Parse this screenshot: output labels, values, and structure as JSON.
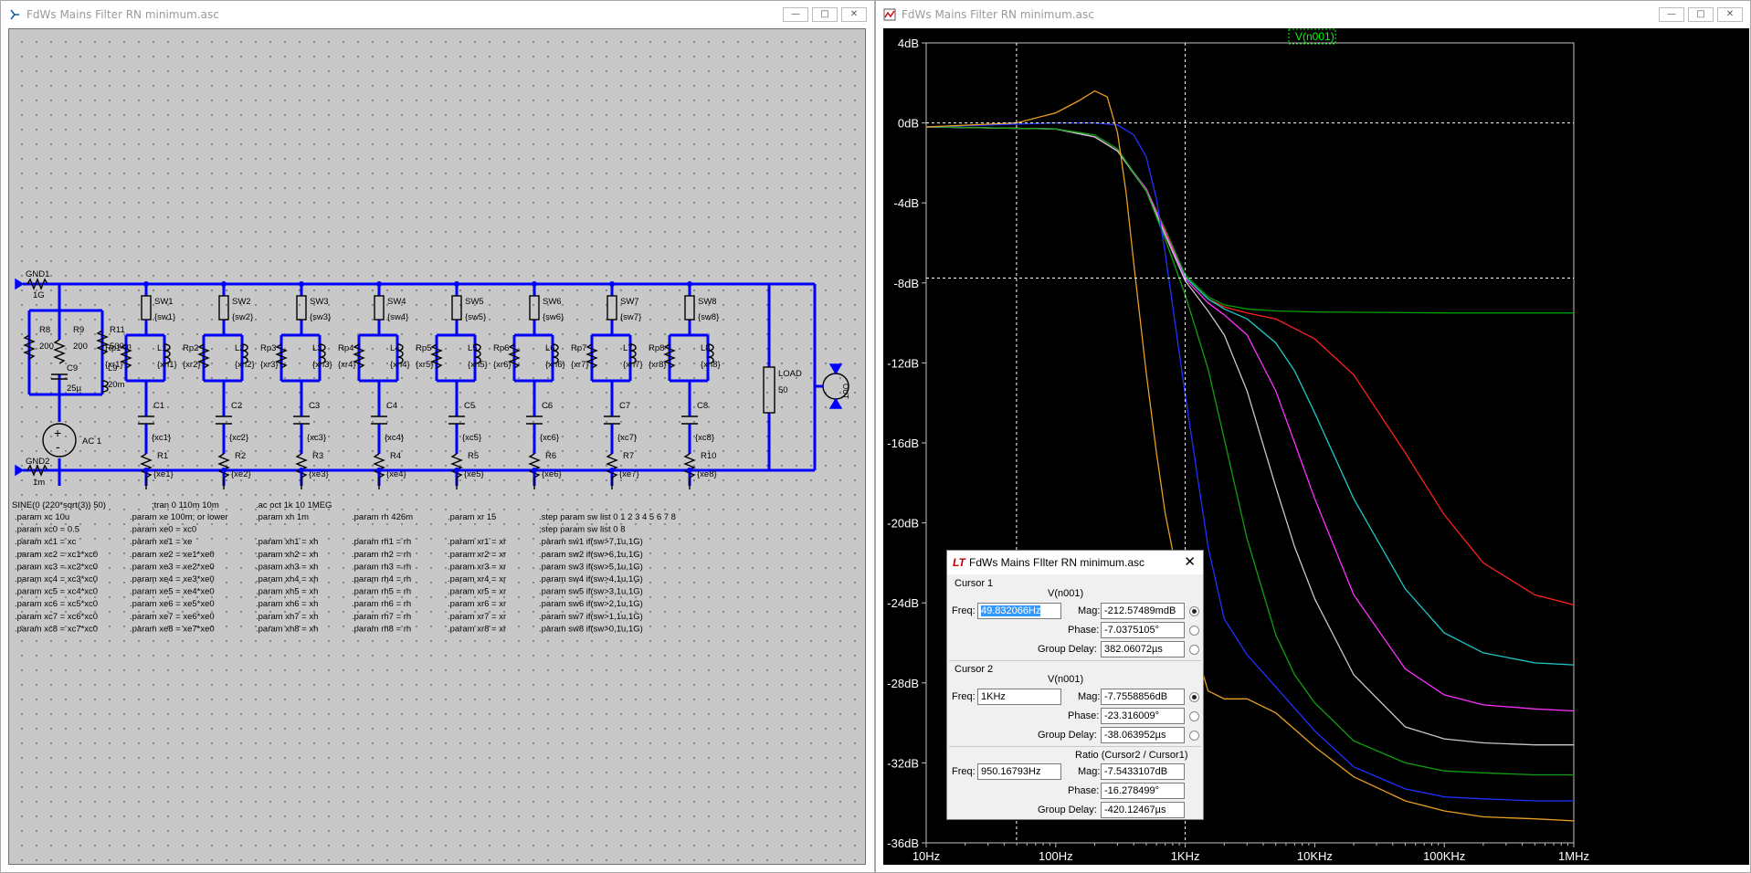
{
  "schematic_window": {
    "title": "FdWs Mains Filter RN minimum.asc",
    "buttons": {
      "minimize": "—",
      "maximize": "□",
      "close": "✕"
    }
  },
  "schematic": {
    "left_labels": {
      "gnd1": "GND1",
      "gnd1_val": "1G",
      "gnd2": "GND2",
      "gnd2_val": "1m",
      "r8": "R8",
      "r8_val": "200",
      "r9": "R9",
      "r9_val": "200",
      "c9": "C9",
      "c9_val": "25µ",
      "r11": "R11",
      "r11_val": "500m",
      "l9": "L9",
      "l9_val": "20m",
      "source": "AC 1"
    },
    "branches": [
      {
        "sw": "SW1",
        "sw_p": "{sw1}",
        "rp": "Rp1",
        "rp_p": "{xr1}",
        "l": "L1",
        "l_p": "{xh1}",
        "c": "C1",
        "c_p": "{xc1}",
        "r": "R1",
        "r_p": "{xe1}"
      },
      {
        "sw": "SW2",
        "sw_p": "{sw2}",
        "rp": "Rp2",
        "rp_p": "{xr2}",
        "l": "L2",
        "l_p": "{xh2}",
        "c": "C2",
        "c_p": "{xc2}",
        "r": "R2",
        "r_p": "{xe2}"
      },
      {
        "sw": "SW3",
        "sw_p": "{sw3}",
        "rp": "Rp3",
        "rp_p": "{xr3}",
        "l": "L3",
        "l_p": "{xh3}",
        "c": "C3",
        "c_p": "{xc3}",
        "r": "R3",
        "r_p": "{xe3}"
      },
      {
        "sw": "SW4",
        "sw_p": "{sw4}",
        "rp": "Rp4",
        "rp_p": "{xr4}",
        "l": "L4",
        "l_p": "{xh4}",
        "c": "C4",
        "c_p": "{xc4}",
        "r": "R4",
        "r_p": "{xe4}"
      },
      {
        "sw": "SW5",
        "sw_p": "{sw5}",
        "rp": "Rp5",
        "rp_p": "{xr5}",
        "l": "L5",
        "l_p": "{xh5}",
        "c": "C5",
        "c_p": "{xc5}",
        "r": "R5",
        "r_p": "{xe5}"
      },
      {
        "sw": "SW6",
        "sw_p": "{sw6}",
        "rp": "Rp6",
        "rp_p": "{xr6}",
        "l": "L6",
        "l_p": "{xh6}",
        "c": "C6",
        "c_p": "{xc6}",
        "r": "R6",
        "r_p": "{xe6}"
      },
      {
        "sw": "SW7",
        "sw_p": "{sw7}",
        "rp": "Rp7",
        "rp_p": "{xr7}",
        "l": "L7",
        "l_p": "{xh7}",
        "c": "C7",
        "c_p": "{xc7}",
        "r": "R7",
        "r_p": "{xe7}"
      },
      {
        "sw": "SW8",
        "sw_p": "{sw8}",
        "rp": "Rp8",
        "rp_p": "{xr8}",
        "l": "L8",
        "l_p": "{xh8}",
        "c": "C8",
        "c_p": "{xc8}",
        "r": "R10",
        "r_p": "{xe8}"
      }
    ],
    "load_label": "LOAD",
    "load_val": "50",
    "out_label": "OUT",
    "spice_lines": {
      "sine": "SINE(0 {220*sqrt(3)} 50)",
      "tran": ";tran 0 110m 10m",
      "ac": ".ac oct 1k 10 1MEG"
    },
    "param_columns": [
      [
        ".param xc 10u",
        ".param xc0 = 0.5",
        ".param xc1 = xc",
        ".param xc2 = xc1*xc0",
        ".param xc3 = xc2*xc0",
        ".param xc4 = xc3*xc0",
        ".param xc5 = xc4*xc0",
        ".param xc6 = xc5*xc0",
        ".param xc7 = xc6*xc0",
        ".param xc8 = xc7*xc0"
      ],
      [
        ".param xe 100m; or lower",
        ".param xe0 = xc0",
        ".param xe1 = xe",
        ".param xe2 = xe1*xe0",
        ".param xe3 = xe2*xe0",
        ".param xe4 = xe3*xe0",
        ".param xe5 = xe4*xe0",
        ".param xe6 = xe5*xe0",
        ".param xe7 = xe6*xe0",
        ".param xe8 = xe7*xe0"
      ],
      [
        ".param xh 1m",
        "",
        ".param xh1 = xh",
        ".param xh2 = xh",
        ".param xh3 = xh",
        ".param xh4 = xh",
        ".param xh5 = xh",
        ".param xh6 = xh",
        ".param xh7 = xh",
        ".param xh8 = xh"
      ],
      [
        ".param rh 426m",
        "",
        ".param rh1 = rh",
        ".param rh2 = rh",
        ".param rh3 = rh",
        ".param rh4 = rh",
        ".param rh5 = rh",
        ".param rh6 = rh",
        ".param rh7 = rh",
        ".param rh8 = rh"
      ],
      [
        ".param xr 15",
        "",
        ".param xr1 = xr",
        ".param xr2 = xr",
        ".param xr3 = xr",
        ".param xr4 = xr",
        ".param xr5 = xr",
        ".param xr6 = xr",
        ".param xr7 = xr",
        ".param xr8 = xr"
      ],
      [
        ".step param sw list 0 1 2 3 4 5 6 7 8",
        ";step param sw list 0 8",
        ".param sw1 if(sw>7,1u,1G)",
        ".param sw2 if(sw>6,1u,1G)",
        ".param sw3 if(sw>5,1u,1G)",
        ".param sw4 if(sw>4,1u,1G)",
        ".param sw5 if(sw>3,1u,1G)",
        ".param sw6 if(sw>2,1u,1G)",
        ".param sw7 if(sw>1,1u,1G)",
        ".param sw8 if(sw>0,1u,1G)"
      ]
    ]
  },
  "plot_window": {
    "title": "FdWs Mains Filter RN minimum.asc",
    "buttons": {
      "minimize": "—",
      "maximize": "□",
      "close": "✕"
    },
    "trace_label": "V(n001)"
  },
  "chart_data": {
    "type": "line",
    "xscale": "log",
    "xlim": [
      10,
      1000000
    ],
    "ylim": [
      -36,
      4
    ],
    "x_ticks": [
      10,
      100,
      1000,
      10000,
      100000,
      1000000
    ],
    "x_tick_labels": [
      "10Hz",
      "100Hz",
      "1KHz",
      "10KHz",
      "100KHz",
      "1MHz"
    ],
    "y_ticks": [
      4,
      0,
      -4,
      -8,
      -12,
      -16,
      -20,
      -24,
      -28,
      -32,
      -36
    ],
    "y_tick_labels": [
      "4dB",
      "0dB",
      "-4dB",
      "-8dB",
      "-12dB",
      "-16dB",
      "-20dB",
      "-24dB",
      "-28dB",
      "-32dB",
      "-36dB"
    ],
    "cursors": {
      "x1": 49.83,
      "x2": 1000,
      "y1": 0,
      "y2": -7.76
    },
    "series": [
      {
        "color": "#00a000",
        "x": [
          10,
          100,
          200,
          300,
          500,
          700,
          1000,
          1500,
          2000,
          3000,
          5000,
          10000,
          100000,
          1000000
        ],
        "y": [
          -0.2,
          -0.3,
          -0.7,
          -1.4,
          -3.3,
          -5.3,
          -7.6,
          -8.7,
          -9.1,
          -9.3,
          -9.4,
          -9.45,
          -9.5,
          -9.5
        ]
      },
      {
        "color": "#ff2020",
        "x": [
          10,
          100,
          200,
          300,
          500,
          700,
          1000,
          1500,
          2000,
          3000,
          5000,
          10000,
          20000,
          50000,
          100000,
          200000,
          500000,
          1000000
        ],
        "y": [
          -0.2,
          -0.3,
          -0.7,
          -1.4,
          -3.3,
          -5.4,
          -7.7,
          -8.8,
          -9.2,
          -9.5,
          -9.8,
          -10.8,
          -12.6,
          -16.5,
          -19.6,
          -22.0,
          -23.6,
          -24.1
        ]
      },
      {
        "color": "#1fc8c8",
        "x": [
          10,
          100,
          200,
          300,
          500,
          700,
          1000,
          1500,
          2000,
          3000,
          5000,
          7000,
          10000,
          20000,
          50000,
          100000,
          200000,
          500000,
          1000000
        ],
        "y": [
          -0.2,
          -0.3,
          -0.7,
          -1.4,
          -3.3,
          -5.5,
          -7.7,
          -8.8,
          -9.3,
          -9.8,
          -11.0,
          -12.4,
          -14.5,
          -18.8,
          -23.3,
          -25.5,
          -26.5,
          -27.0,
          -27.1
        ]
      },
      {
        "color": "#ff30ff",
        "x": [
          10,
          100,
          200,
          300,
          500,
          700,
          1000,
          1500,
          2000,
          3000,
          5000,
          7000,
          10000,
          20000,
          50000,
          100000,
          200000,
          500000,
          1000000
        ],
        "y": [
          -0.2,
          -0.3,
          -0.7,
          -1.4,
          -3.3,
          -5.5,
          -7.8,
          -9.0,
          -9.6,
          -10.6,
          -13.4,
          -16.0,
          -18.8,
          -23.6,
          -27.3,
          -28.6,
          -29.1,
          -29.3,
          -29.4
        ]
      },
      {
        "color": "#c8c8c8",
        "x": [
          10,
          100,
          200,
          300,
          500,
          700,
          1000,
          1500,
          2000,
          3000,
          5000,
          7000,
          10000,
          20000,
          50000,
          100000,
          200000,
          500000,
          1000000
        ],
        "y": [
          -0.2,
          -0.3,
          -0.7,
          -1.4,
          -3.4,
          -5.6,
          -7.9,
          -9.4,
          -10.6,
          -13.4,
          -18.2,
          -21.2,
          -23.8,
          -27.6,
          -30.2,
          -30.8,
          -31.0,
          -31.1,
          -31.1
        ]
      },
      {
        "color": "#10a010",
        "x": [
          10,
          100,
          200,
          300,
          500,
          700,
          1000,
          1500,
          2000,
          3000,
          5000,
          7000,
          10000,
          20000,
          50000,
          100000,
          200000,
          500000,
          1000000
        ],
        "y": [
          -0.2,
          -0.3,
          -0.6,
          -1.3,
          -3.4,
          -5.8,
          -8.6,
          -12.3,
          -15.8,
          -20.8,
          -25.6,
          -27.6,
          -29.0,
          -30.9,
          -32.0,
          -32.4,
          -32.5,
          -32.6,
          -32.6
        ]
      },
      {
        "color": "#2030ff",
        "x": [
          10,
          100,
          200,
          300,
          400,
          500,
          600,
          700,
          1000,
          1500,
          2000,
          3000,
          5000,
          10000,
          20000,
          50000,
          100000,
          200000,
          500000,
          1000000
        ],
        "y": [
          -0.2,
          0.0,
          0.0,
          -0.1,
          -0.6,
          -1.7,
          -3.8,
          -6.5,
          -13.6,
          -21.2,
          -24.8,
          -26.6,
          -28.2,
          -30.4,
          -32.2,
          -33.3,
          -33.7,
          -33.8,
          -33.9,
          -33.9
        ]
      },
      {
        "color": "#e8a020",
        "x": [
          10,
          50,
          100,
          150,
          200,
          250,
          300,
          350,
          400,
          500,
          600,
          700,
          1000,
          1500,
          2000,
          3000,
          5000,
          10000,
          20000,
          50000,
          100000,
          200000,
          500000,
          1000000
        ],
        "y": [
          -0.2,
          0.0,
          0.5,
          1.1,
          1.6,
          1.3,
          -0.5,
          -3.5,
          -7.0,
          -12.5,
          -16.5,
          -19.5,
          -24.6,
          -28.4,
          -28.8,
          -28.8,
          -29.5,
          -31.2,
          -32.7,
          -33.9,
          -34.4,
          -34.7,
          -34.8,
          -34.9
        ]
      }
    ]
  },
  "cursor_dialog": {
    "title": "FdWs Mains FIlter RN minimum.asc",
    "cursor1": {
      "heading": "Cursor 1",
      "trace": "V(n001)",
      "freq_label": "Freq:",
      "freq": "49.832066Hz",
      "mag_label": "Mag:",
      "mag": "-212.57489mdB",
      "phase_label": "Phase:",
      "phase": "-7.0375105°",
      "gd_label": "Group Delay:",
      "gd": "382.06072µs"
    },
    "cursor2": {
      "heading": "Cursor 2",
      "trace": "V(n001)",
      "freq_label": "Freq:",
      "freq": "1KHz",
      "mag_label": "Mag:",
      "mag": "-7.7558856dB",
      "phase_label": "Phase:",
      "phase": "-23.316009°",
      "gd_label": "Group Delay:",
      "gd": "-38.063952µs"
    },
    "ratio": {
      "heading": "Ratio (Cursor2 / Cursor1)",
      "freq_label": "Freq:",
      "freq": "950.16793Hz",
      "mag_label": "Mag:",
      "mag": "-7.5433107dB",
      "phase_label": "Phase:",
      "phase": "-16.278499°",
      "gd_label": "Group Delay:",
      "gd": "-420.12467µs"
    }
  }
}
